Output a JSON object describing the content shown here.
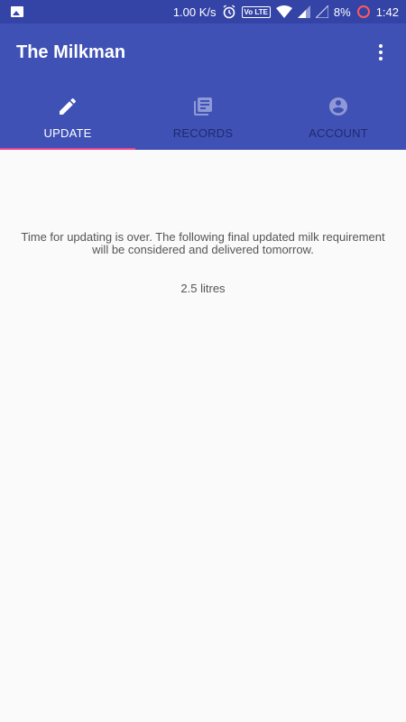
{
  "status_bar": {
    "net_speed": "1.00 K/s",
    "volte": "Vo LTE",
    "battery": "8%",
    "time": "1:42"
  },
  "app_bar": {
    "title": "The Milkman"
  },
  "tabs": [
    {
      "label": "UPDATE",
      "icon": "pencil-icon",
      "active": true
    },
    {
      "label": "RECORDS",
      "icon": "records-icon",
      "active": false
    },
    {
      "label": "ACCOUNT",
      "icon": "account-icon",
      "active": false
    }
  ],
  "main": {
    "message": "Time for updating is over. The following final updated milk requirement will be considered and delivered tomorrow.",
    "requirement": "2.5 litres"
  },
  "colors": {
    "status_bar": "#3443a6",
    "primary": "#3f51b5",
    "accent": "#e8458d",
    "inactive_tab": "#1f2a6e",
    "background": "#fafafa"
  }
}
